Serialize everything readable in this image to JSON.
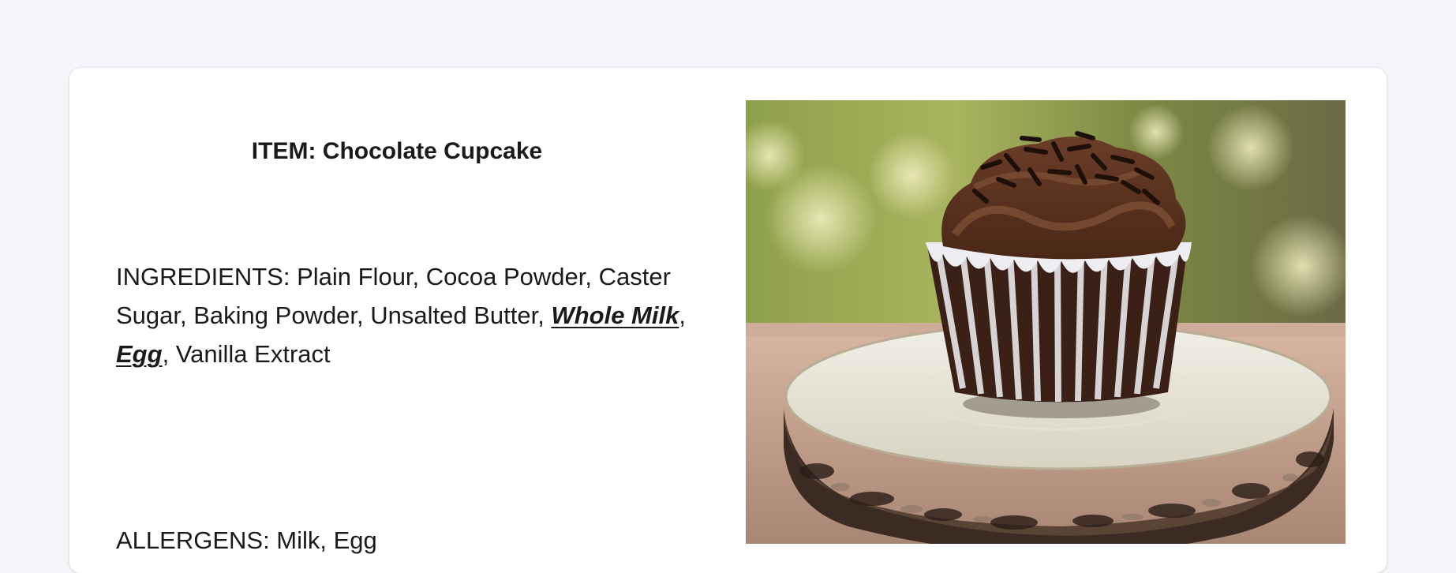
{
  "item": {
    "title": "ITEM: Chocolate Cupcake"
  },
  "ingredients": {
    "prefix": "INGREDIENTS: Plain Flour, Cocoa Powder, Caster Sugar, Baking Powder, Unsalted Butter, ",
    "allergen_1": "Whole Milk",
    "sep_1": ", ",
    "allergen_2": "Egg",
    "suffix": ", Vanilla Extract"
  },
  "allergens": {
    "text": "ALLERGENS: Milk, Egg"
  },
  "photo": {
    "subject": "chocolate-cupcake-photo"
  },
  "colors": {
    "page_background": "#f4f5f8",
    "card_background": "#ffffff",
    "text": "#1a1a1a"
  }
}
